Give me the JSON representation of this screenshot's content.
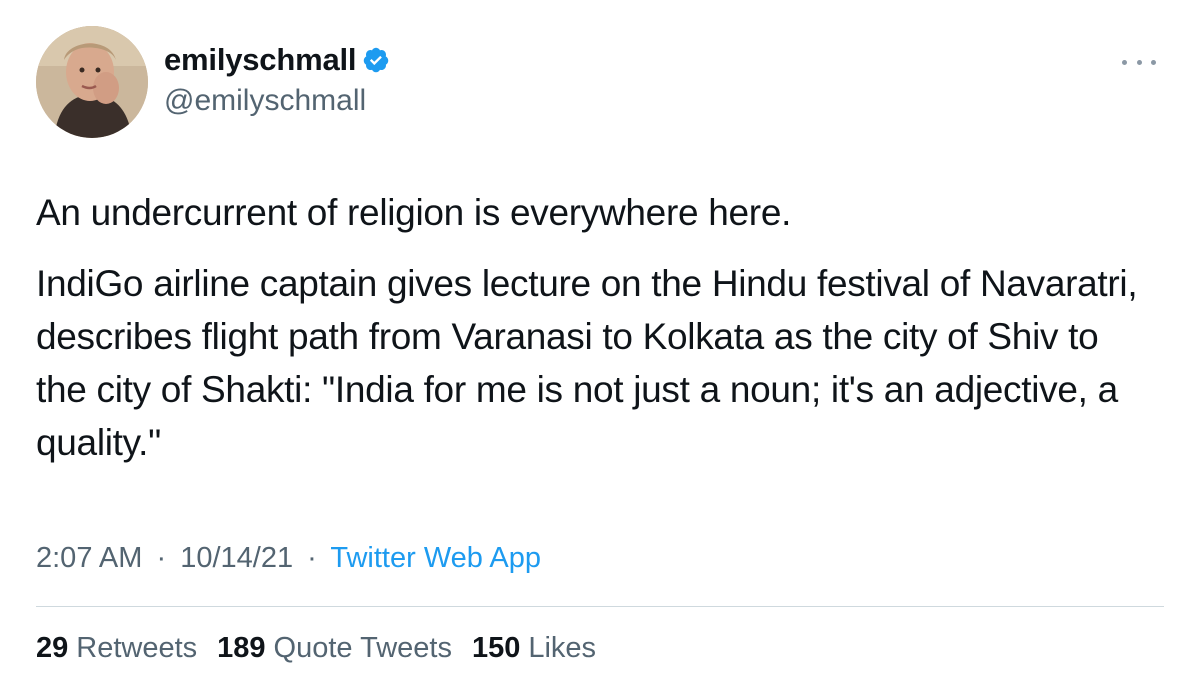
{
  "author": {
    "display_name": "emilyschmall",
    "handle": "@emilyschmall",
    "verified": true
  },
  "tweet": {
    "paragraphs": [
      "An undercurrent of religion is everywhere here.",
      "IndiGo airline captain gives lecture on the Hindu festival of Navaratri, describes flight path from Varanasi to Kolkata as the city of Shiv to the city of Shakti: \"India for me is not just a noun; it's an adjective, a quality.\""
    ]
  },
  "meta": {
    "time": "2:07 AM",
    "date": "10/14/21",
    "source": "Twitter Web App",
    "separator": "·"
  },
  "stats": {
    "retweets_count": "29",
    "retweets_label": "Retweets",
    "quote_tweets_count": "189",
    "quote_tweets_label": "Quote Tweets",
    "likes_count": "150",
    "likes_label": "Likes"
  },
  "colors": {
    "text_primary": "#0f1419",
    "text_secondary": "#536471",
    "accent": "#1d9bf0",
    "divider": "#cfd9de"
  },
  "icons": {
    "verified": "verified-badge-icon",
    "more": "more-options-icon"
  }
}
